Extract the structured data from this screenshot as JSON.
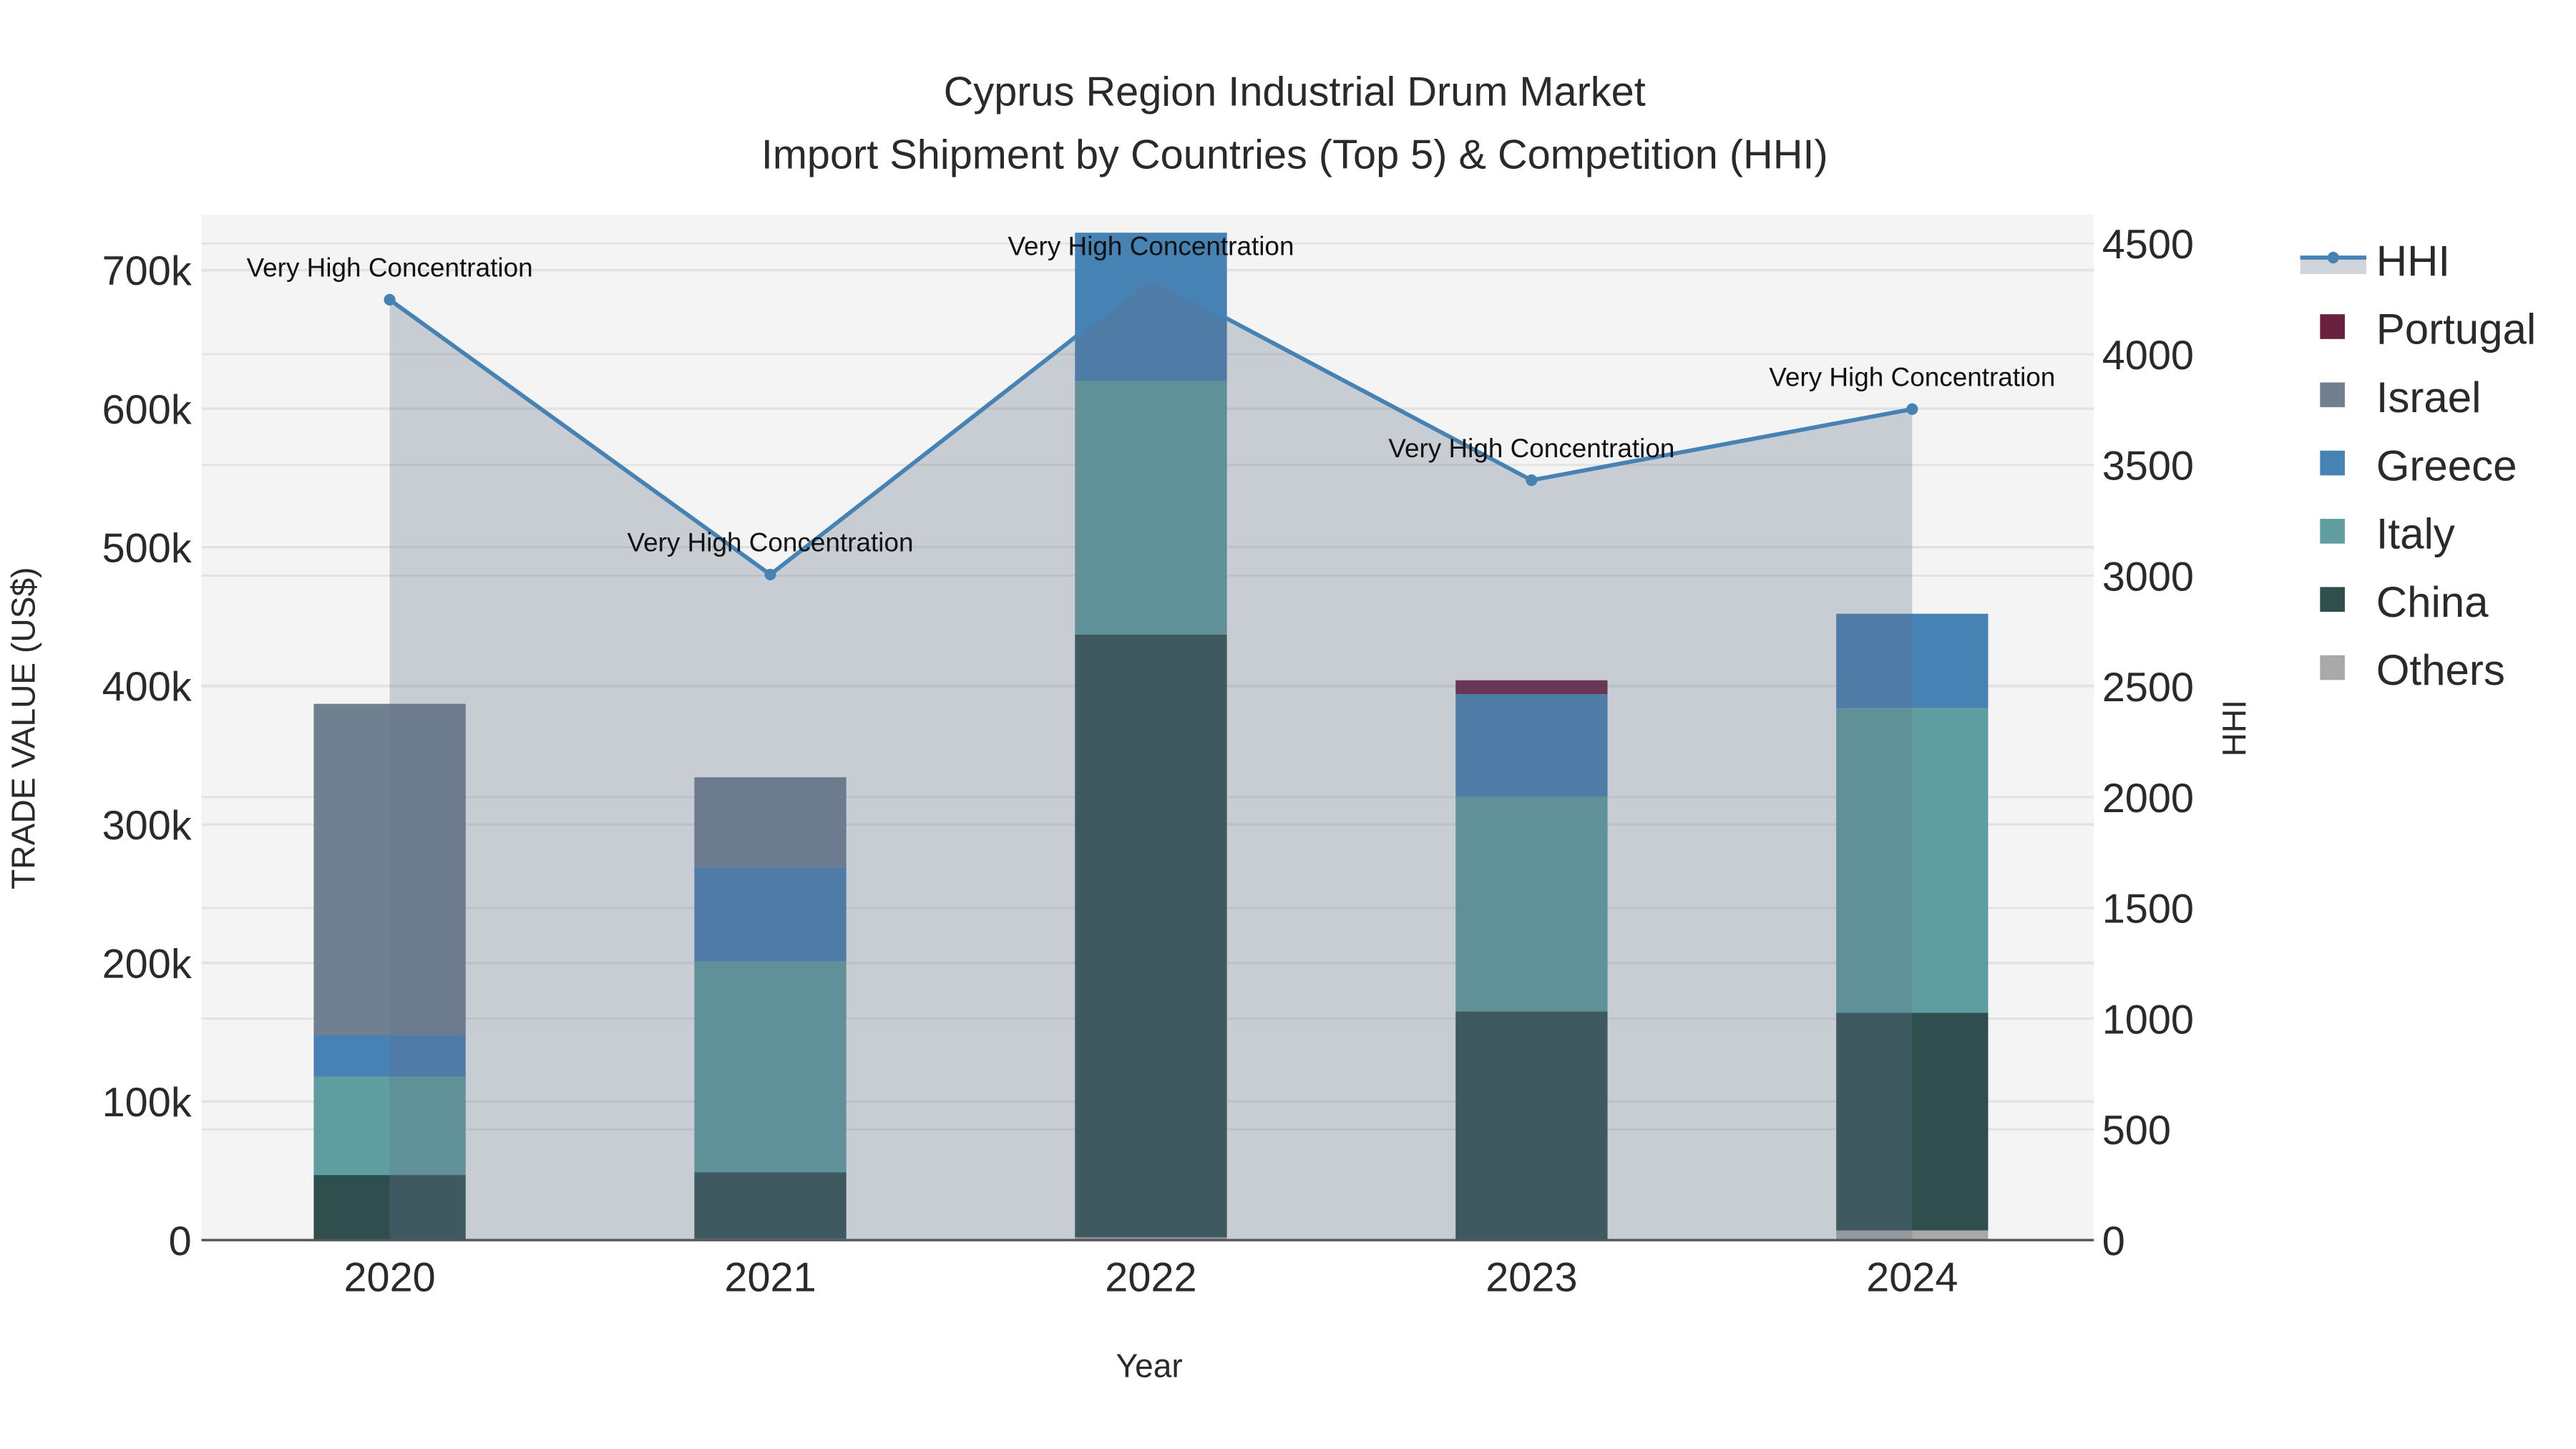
{
  "chart_data": {
    "type": "bar",
    "stacked": true,
    "title": "Cyprus Region Industrial Drum Market",
    "subtitle": "Import Shipment by Countries (Top 5) & Competition (HHI)",
    "xlabel": "Year",
    "ylabel": "TRADE VALUE (US$)",
    "y2label": "HHI",
    "categories": [
      "2020",
      "2021",
      "2022",
      "2023",
      "2024"
    ],
    "ylim": [
      0,
      740000
    ],
    "y2lim": [
      0,
      4630
    ],
    "yticks": [
      0,
      100000,
      200000,
      300000,
      400000,
      500000,
      600000,
      700000
    ],
    "ytick_labels": [
      "0",
      "100k",
      "200k",
      "300k",
      "400k",
      "500k",
      "600k",
      "700k"
    ],
    "y2ticks": [
      0,
      500,
      1000,
      1500,
      2000,
      2500,
      3000,
      3500,
      4000,
      4500
    ],
    "y2tick_labels": [
      "0",
      "500",
      "1000",
      "1500",
      "2000",
      "2500",
      "3000",
      "3500",
      "4000",
      "4500"
    ],
    "series": [
      {
        "name": "Others",
        "color": "#a9a9a9",
        "values": [
          0,
          1000,
          2000,
          0,
          7000
        ]
      },
      {
        "name": "China",
        "color": "#2f4f4f",
        "values": [
          47000,
          48000,
          435000,
          165000,
          157000
        ]
      },
      {
        "name": "Italy",
        "color": "#5f9ea0",
        "values": [
          71000,
          152000,
          183000,
          155000,
          220000
        ]
      },
      {
        "name": "Greece",
        "color": "#4682b4",
        "values": [
          30000,
          68000,
          107000,
          74000,
          68000
        ]
      },
      {
        "name": "Israel",
        "color": "#708090",
        "values": [
          239000,
          65000,
          0,
          0,
          0
        ]
      },
      {
        "name": "Portugal",
        "color": "#6b1f3f",
        "values": [
          0,
          0,
          0,
          10000,
          0
        ]
      }
    ],
    "hhi": {
      "name": "HHI",
      "color": "#4682b4",
      "values": [
        4246,
        3005,
        4343,
        3431,
        3752
      ]
    },
    "annotations": [
      "Very High Concentration",
      "Very High Concentration",
      "Very High Concentration",
      "Very High Concentration",
      "Very High Concentration"
    ],
    "legend": [
      "HHI",
      "Portugal",
      "Israel",
      "Greece",
      "Italy",
      "China",
      "Others"
    ],
    "legend_position": "right",
    "grid": true
  }
}
